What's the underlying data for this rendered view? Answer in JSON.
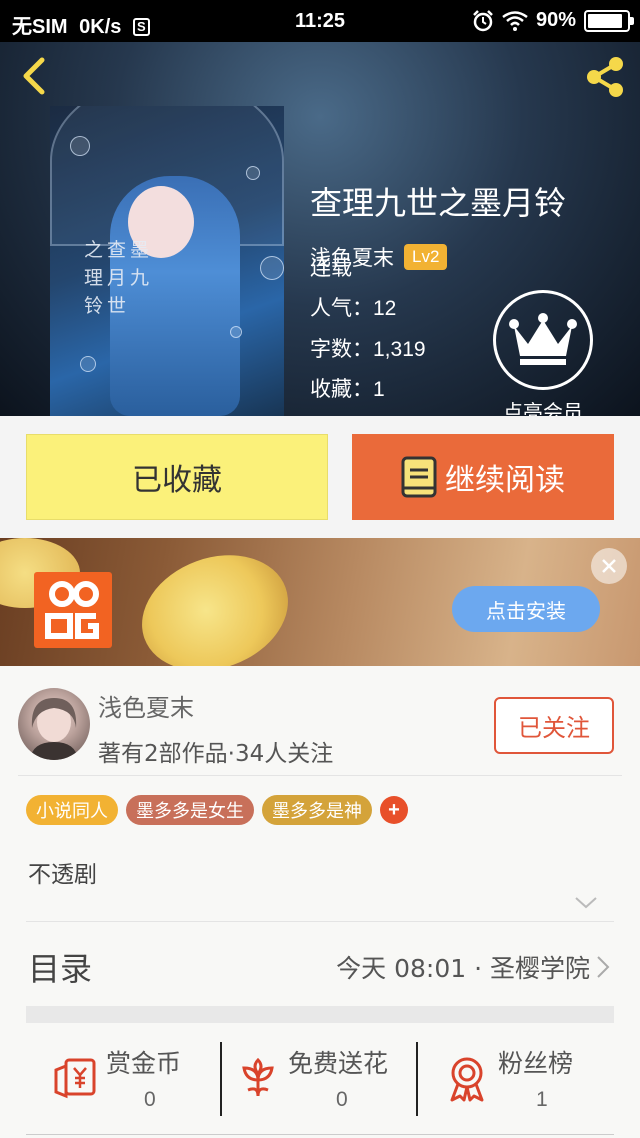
{
  "status_bar": {
    "carrier": "无SIM",
    "speed": "0K/s",
    "sim_icon_letter": "S",
    "time": "11:25",
    "battery": "90%",
    "battery_level": 0.9
  },
  "header": {
    "back_icon": "back-chevron-icon",
    "share_icon": "share-icon"
  },
  "book": {
    "title": "查理九世之墨月铃",
    "author": "浅色夏末",
    "author_level": "Lv2",
    "status": "连载",
    "popularity_label": "人气：",
    "popularity": "12",
    "words_label": "字数：",
    "words": "1,319",
    "favorites_label": "收藏：",
    "favorites": "1",
    "cover_text": "之查墨理月九铃世",
    "vip_label": "点亮会员"
  },
  "buttons": {
    "collected": "已收藏",
    "continue_reading": "继续阅读"
  },
  "ad": {
    "install_label": "点击安装",
    "close_icon": "close-icon"
  },
  "author_card": {
    "name": "浅色夏末",
    "stats": "著有2部作品·34人关注",
    "follow_label": "已关注"
  },
  "tags": [
    {
      "label": "小说同人",
      "color": "#f2b233"
    },
    {
      "label": "墨多多是女生",
      "color": "#c8705a"
    },
    {
      "label": "墨多多是神",
      "color": "#d4a33a"
    }
  ],
  "tag_add_symbol": "+",
  "summary": "不透剧",
  "toc": {
    "title": "目录",
    "latest": "今天 08:01 · 圣樱学院"
  },
  "actions": [
    {
      "label": "赏金币",
      "count": "0",
      "icon": "reward-coin-icon"
    },
    {
      "label": "免费送花",
      "count": "0",
      "icon": "flower-icon"
    },
    {
      "label": "粉丝榜",
      "count": "1",
      "icon": "medal-icon"
    }
  ],
  "colors": {
    "accent_orange": "#ea6a3a",
    "collected_yellow": "#fbf17a",
    "follow_red": "#e0563a",
    "install_blue": "#6ca8ef"
  }
}
